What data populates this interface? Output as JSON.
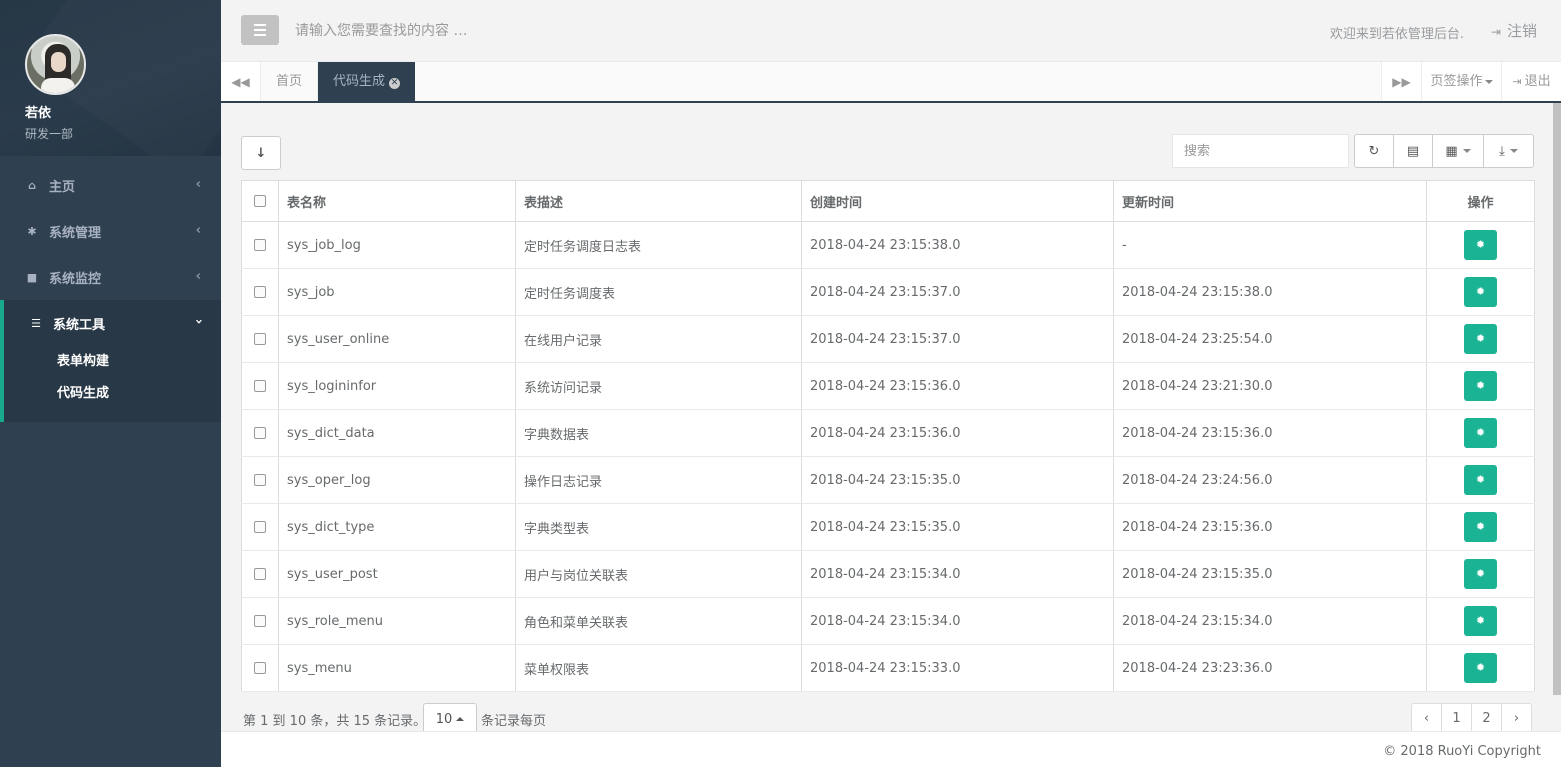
{
  "sidebar": {
    "user": {
      "name": "若依",
      "dept": "研发一部"
    },
    "items": [
      {
        "label": "主页",
        "icon": "home-icon",
        "arrow": "‹"
      },
      {
        "label": "系统管理",
        "icon": "gear-icon",
        "arrow": "‹"
      },
      {
        "label": "系统监控",
        "icon": "video-camera-icon",
        "arrow": "‹"
      },
      {
        "label": "系统工具",
        "icon": "bars-icon",
        "arrow": "›"
      }
    ],
    "subitems": [
      {
        "label": "表单构建"
      },
      {
        "label": "代码生成"
      }
    ]
  },
  "topbar": {
    "search_placeholder": "请输入您需要查找的内容 …",
    "welcome": "欢迎来到若依管理后台.",
    "logout": "注销"
  },
  "tabs": {
    "home": "首页",
    "active": "代码生成",
    "page_ops": "页签操作",
    "exit": "退出"
  },
  "toolbar": {
    "search_placeholder": "搜索"
  },
  "table": {
    "headers": [
      "表名称",
      "表描述",
      "创建时间",
      "更新时间",
      "操作"
    ],
    "rows": [
      {
        "name": "sys_job_log",
        "desc": "定时任务调度日志表",
        "created": "2018-04-24 23:15:38.0",
        "updated": "-"
      },
      {
        "name": "sys_job",
        "desc": "定时任务调度表",
        "created": "2018-04-24 23:15:37.0",
        "updated": "2018-04-24 23:15:38.0"
      },
      {
        "name": "sys_user_online",
        "desc": "在线用户记录",
        "created": "2018-04-24 23:15:37.0",
        "updated": "2018-04-24 23:25:54.0"
      },
      {
        "name": "sys_logininfor",
        "desc": "系统访问记录",
        "created": "2018-04-24 23:15:36.0",
        "updated": "2018-04-24 23:21:30.0"
      },
      {
        "name": "sys_dict_data",
        "desc": "字典数据表",
        "created": "2018-04-24 23:15:36.0",
        "updated": "2018-04-24 23:15:36.0"
      },
      {
        "name": "sys_oper_log",
        "desc": "操作日志记录",
        "created": "2018-04-24 23:15:35.0",
        "updated": "2018-04-24 23:24:56.0"
      },
      {
        "name": "sys_dict_type",
        "desc": "字典类型表",
        "created": "2018-04-24 23:15:35.0",
        "updated": "2018-04-24 23:15:36.0"
      },
      {
        "name": "sys_user_post",
        "desc": "用户与岗位关联表",
        "created": "2018-04-24 23:15:34.0",
        "updated": "2018-04-24 23:15:35.0"
      },
      {
        "name": "sys_role_menu",
        "desc": "角色和菜单关联表",
        "created": "2018-04-24 23:15:34.0",
        "updated": "2018-04-24 23:15:34.0"
      },
      {
        "name": "sys_menu",
        "desc": "菜单权限表",
        "created": "2018-04-24 23:15:33.0",
        "updated": "2018-04-24 23:23:36.0"
      }
    ]
  },
  "pager": {
    "summary": "第 1 到 10 条，共 15 条记录。",
    "page_size": "10",
    "per_page_suffix": "条记录每页",
    "prev": "‹",
    "pages": [
      "1",
      "2"
    ],
    "next": "›"
  },
  "footer": {
    "copyright": "© 2018 RuoYi Copyright"
  },
  "colors": {
    "sidebar": "#2f4050",
    "accent": "#1ab394",
    "active_border": "#19aa8d"
  }
}
